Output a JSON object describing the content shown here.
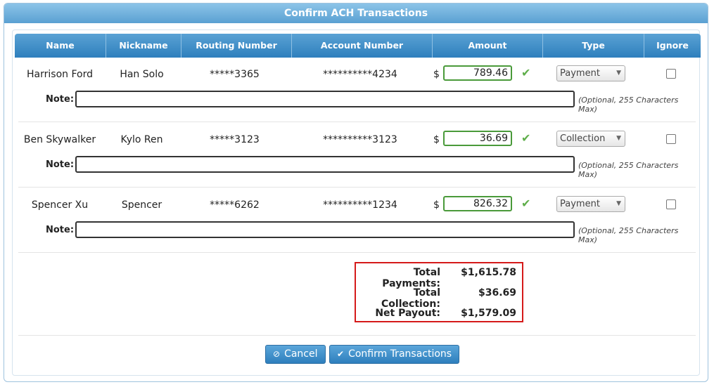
{
  "dialog": {
    "title": "Confirm ACH Transactions"
  },
  "columns": [
    "Name",
    "Nickname",
    "Routing Number",
    "Account Number",
    "Amount",
    "Type",
    "Ignore"
  ],
  "note_label": "Note:",
  "note_hint": "(Optional, 255 Characters Max)",
  "currency_symbol": "$",
  "rows": [
    {
      "name": "Harrison Ford",
      "nickname": "Han Solo",
      "routing": "*****3365",
      "account": "**********4234",
      "amount": "789.46",
      "type": "Payment",
      "ignore": false
    },
    {
      "name": "Ben Skywalker",
      "nickname": "Kylo Ren",
      "routing": "*****3123",
      "account": "**********3123",
      "amount": "36.69",
      "type": "Collection",
      "ignore": false
    },
    {
      "name": "Spencer Xu",
      "nickname": "Spencer",
      "routing": "*****6262",
      "account": "**********1234",
      "amount": "826.32",
      "type": "Payment",
      "ignore": false
    }
  ],
  "totals": {
    "payments_label": "Total Payments:",
    "payments_value": "$1,615.78",
    "collection_label": "Total Collection:",
    "collection_value": "$36.69",
    "net_label": "Net Payout:",
    "net_value": "$1,579.09"
  },
  "buttons": {
    "cancel": "Cancel",
    "confirm": "Confirm Transactions"
  },
  "icons": {
    "valid": "checkmark-icon",
    "cancel": "cancel-icon",
    "confirm": "check-icon",
    "dropdown": "caret-down-icon"
  },
  "colors": {
    "header": "#2e7fbd",
    "valid": "#4a9a3a",
    "highlight": "#d51a1a"
  }
}
